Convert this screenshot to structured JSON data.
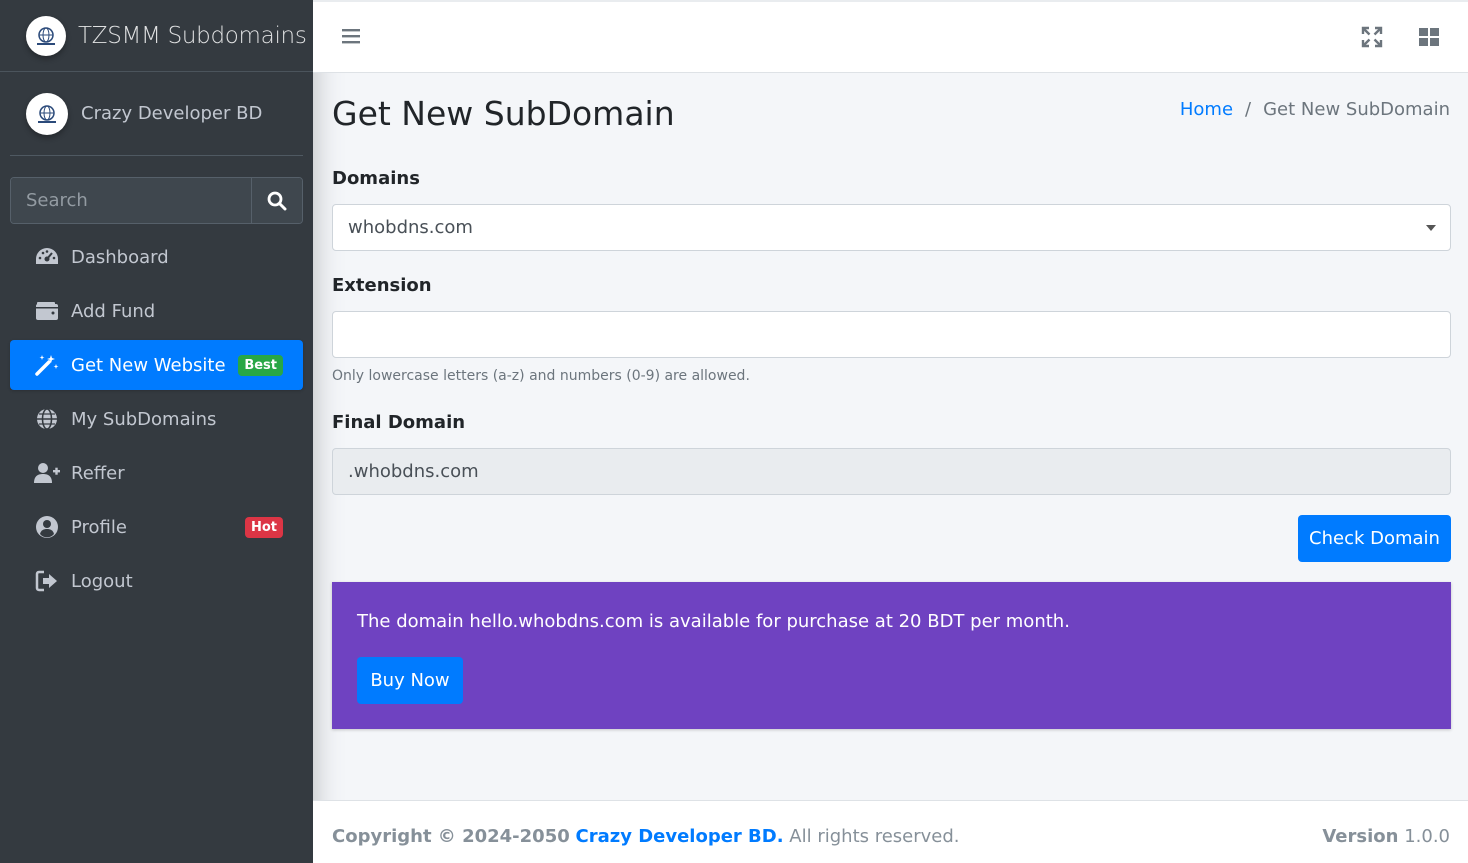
{
  "brand": {
    "name": "TZSMM Subdomains"
  },
  "user": {
    "name": "Crazy Developer BD"
  },
  "search": {
    "placeholder": "Search"
  },
  "sidebar": {
    "items": [
      {
        "label": "Dashboard",
        "icon": "dashboard-icon"
      },
      {
        "label": "Add Fund",
        "icon": "wallet-icon"
      },
      {
        "label": "Get New Website",
        "icon": "magic-wand-icon",
        "active": true,
        "badge": "Best"
      },
      {
        "label": "My SubDomains",
        "icon": "globe-icon"
      },
      {
        "label": "Reffer",
        "icon": "user-plus-icon"
      },
      {
        "label": "Profile",
        "icon": "user-circle-icon",
        "badge": "Hot"
      },
      {
        "label": "Logout",
        "icon": "sign-out-icon"
      }
    ]
  },
  "page": {
    "title": "Get New SubDomain",
    "breadcrumb": {
      "home": "Home",
      "separator": "/",
      "current": "Get New SubDomain"
    }
  },
  "form": {
    "domains_label": "Domains",
    "domains_value": "whobdns.com",
    "extension_label": "Extension",
    "extension_value": "",
    "extension_help": "Only lowercase letters (a-z) and numbers (0-9) are allowed.",
    "final_label": "Final Domain",
    "final_value": ".whobdns.com",
    "check_button": "Check Domain"
  },
  "alert": {
    "message": "The domain hello.whobdns.com is available for purchase at 20 BDT per month.",
    "buy_button": "Buy Now"
  },
  "footer": {
    "copyright_prefix": "Copyright © 2024-2050",
    "brand": "Crazy Developer BD.",
    "rights": "All rights reserved.",
    "version_label": "Version",
    "version_value": "1.0.0"
  },
  "colors": {
    "sidebar_bg": "#343a40",
    "primary": "#007bff",
    "alert_purple": "#6f42c1",
    "badge_success": "#28a745",
    "badge_danger": "#dc3545"
  }
}
